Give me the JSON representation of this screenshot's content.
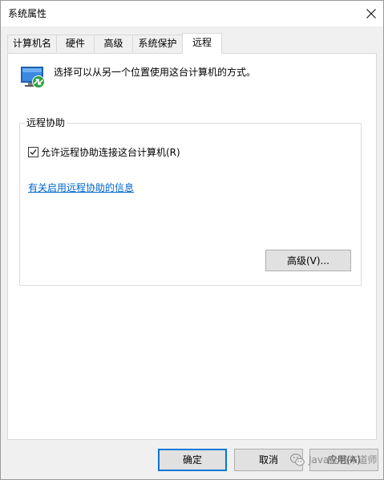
{
  "window": {
    "title": "系统属性"
  },
  "tabs": [
    {
      "label": "计算机名"
    },
    {
      "label": "硬件"
    },
    {
      "label": "高级"
    },
    {
      "label": "系统保护"
    },
    {
      "label": "远程",
      "active": true
    }
  ],
  "remote_tab": {
    "intro": "选择可以从另一个位置使用这台计算机的方式。",
    "remote_assistance": {
      "group_title": "远程协助",
      "checkbox_label": "允许远程协助连接这台计算机(R)",
      "checkbox_checked": true,
      "help_link": "有关启用远程协助的信息",
      "advanced_button": "高级(V)..."
    }
  },
  "footer": {
    "ok_label": "确定",
    "cancel_label": "取消",
    "apply_label": "应用(A)"
  },
  "watermark": {
    "text": "Java全栈布道师",
    "icon": "wechat-icon"
  },
  "colors": {
    "link": "#0066cc",
    "default_button_border": "#0078d7",
    "window_bg": "#f0f0f0"
  },
  "icons": {
    "close": "close-icon",
    "remote": "remote-computer-icon",
    "check": "checkmark-icon"
  }
}
